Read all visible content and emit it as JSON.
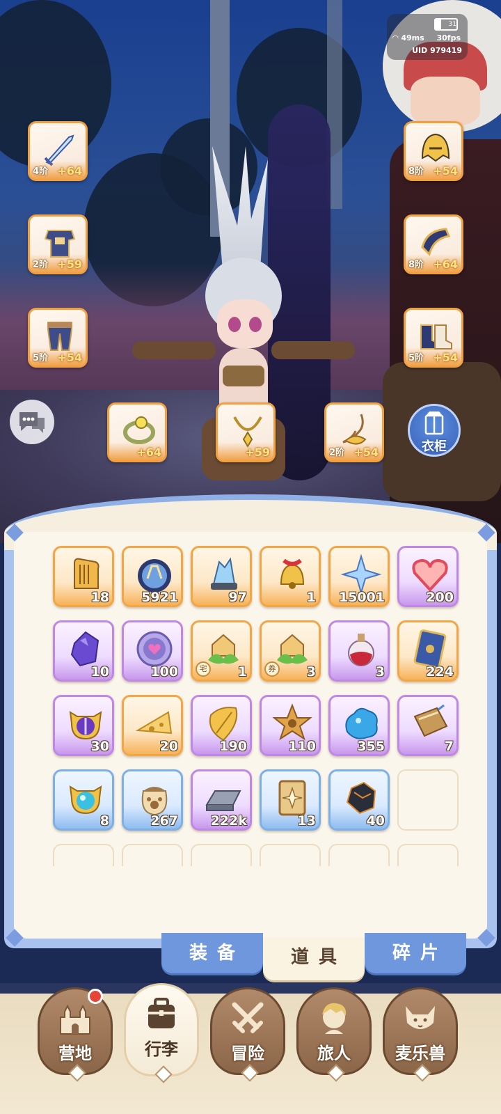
{
  "status": {
    "ping": "49ms",
    "fps": "30fps",
    "uid": "UID 979419",
    "battery": "31"
  },
  "equipment": {
    "left": [
      {
        "name": "sword",
        "tier": "4阶",
        "level": "+64"
      },
      {
        "name": "armor",
        "tier": "2阶",
        "level": "+59"
      },
      {
        "name": "pants",
        "tier": "5阶",
        "level": "+54"
      }
    ],
    "right": [
      {
        "name": "helmet",
        "tier": "8阶",
        "level": "+54"
      },
      {
        "name": "bracer",
        "tier": "8阶",
        "level": "+64"
      },
      {
        "name": "boots",
        "tier": "5阶",
        "level": "+54"
      }
    ],
    "bottom": [
      {
        "name": "ring",
        "tier": "",
        "level": "+64"
      },
      {
        "name": "necklace",
        "tier": "",
        "level": "+59"
      },
      {
        "name": "charm",
        "tier": "2阶",
        "level": "+54"
      }
    ]
  },
  "wardrobe_label": "衣柜",
  "inventory": {
    "rows": [
      [
        {
          "icon": "lyre-icon",
          "count": "18",
          "rarity": "orange"
        },
        {
          "icon": "orb-icon",
          "count": "5921",
          "rarity": "orange"
        },
        {
          "icon": "crystal-shard-icon",
          "count": "97",
          "rarity": "orange"
        },
        {
          "icon": "bell-icon",
          "count": "1",
          "rarity": "orange"
        },
        {
          "icon": "star-crystal-icon",
          "count": "15001",
          "rarity": "orange"
        },
        {
          "icon": "heart-icon",
          "count": "200",
          "rarity": "purple"
        }
      ],
      [
        {
          "icon": "purple-gem-icon",
          "count": "10",
          "rarity": "purple"
        },
        {
          "icon": "heart-coin-icon",
          "count": "100",
          "rarity": "purple"
        },
        {
          "icon": "house-plant-icon",
          "count": "1",
          "rarity": "orange",
          "tag": "宅"
        },
        {
          "icon": "house-plant-icon",
          "count": "3",
          "rarity": "orange",
          "tag": "券"
        },
        {
          "icon": "potion-icon",
          "count": "3",
          "rarity": "purple"
        },
        {
          "icon": "card-icon",
          "count": "224",
          "rarity": "orange"
        }
      ],
      [
        {
          "icon": "cat-lens-purple-icon",
          "count": "30",
          "rarity": "purple"
        },
        {
          "icon": "cheese-icon",
          "count": "20",
          "rarity": "orange"
        },
        {
          "icon": "leaf-icon",
          "count": "190",
          "rarity": "purple"
        },
        {
          "icon": "star-cookie-icon",
          "count": "110",
          "rarity": "purple"
        },
        {
          "icon": "blue-slime-icon",
          "count": "355",
          "rarity": "purple"
        },
        {
          "icon": "book-icon",
          "count": "7",
          "rarity": "purple"
        }
      ],
      [
        {
          "icon": "cat-lens-blue-icon",
          "count": "8",
          "rarity": "blue"
        },
        {
          "icon": "paw-bag-icon",
          "count": "267",
          "rarity": "blue"
        },
        {
          "icon": "metal-ingot-icon",
          "count": "222k",
          "rarity": "purple"
        },
        {
          "icon": "sparkle-card-icon",
          "count": "13",
          "rarity": "blue"
        },
        {
          "icon": "ore-icon",
          "count": "40",
          "rarity": "blue"
        },
        {
          "icon": "",
          "count": "",
          "rarity": "empty"
        }
      ]
    ]
  },
  "tabs": [
    {
      "label": "装备"
    },
    {
      "label": "道具",
      "active": true
    },
    {
      "label": "碎片"
    }
  ],
  "nav": [
    {
      "label": "营地",
      "icon": "castle-icon",
      "badge": true
    },
    {
      "label": "行李",
      "icon": "backpack-icon",
      "active": true
    },
    {
      "label": "冒险",
      "icon": "crossed-swords-icon"
    },
    {
      "label": "旅人",
      "icon": "traveler-icon"
    },
    {
      "label": "麦乐兽",
      "icon": "cat-beast-icon"
    }
  ]
}
